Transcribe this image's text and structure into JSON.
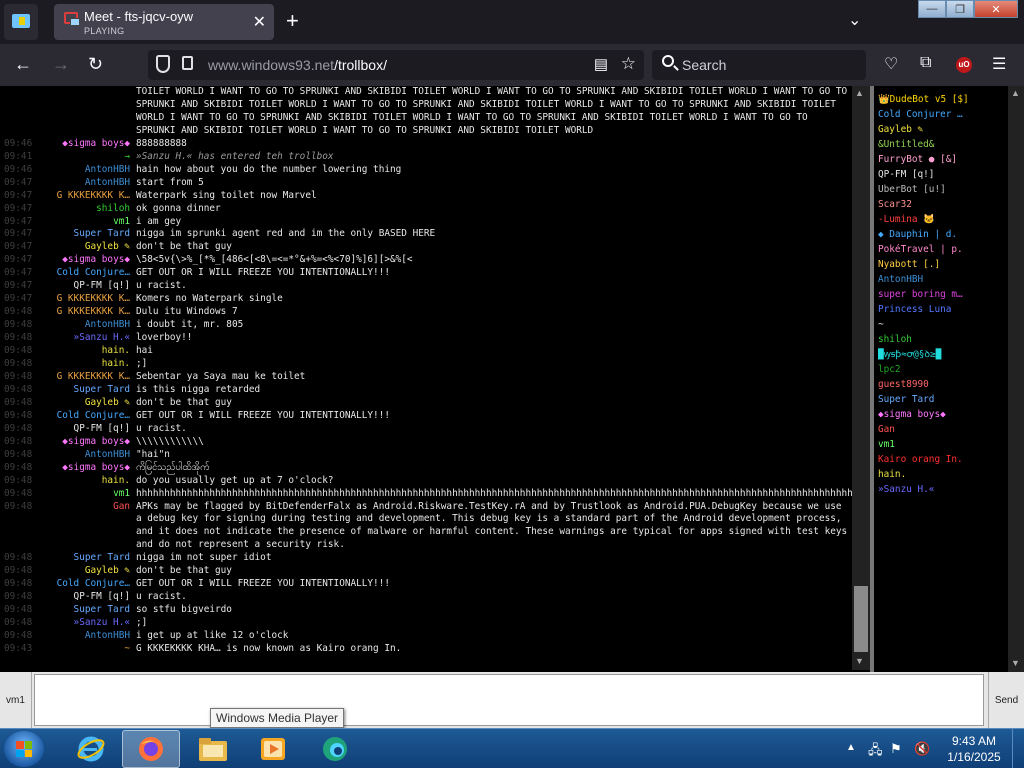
{
  "browser": {
    "tab_title": "Meet - fts-jqcv-oyw",
    "tab_status": "PLAYING",
    "new_tab": "+",
    "url_domain": "www.windows93.net",
    "url_path": "/trollbox/",
    "search_placeholder": "Search",
    "ublock": "uO",
    "window_controls": {
      "minimize": "—",
      "maximize": "❐",
      "close": "✕"
    }
  },
  "chat": {
    "messages": [
      {
        "time": "",
        "name": "",
        "name_color": "#ffffff",
        "text": "TOILET WORLD I WANT TO GO TO SPRUNKI AND SKIBIDI TOILET WORLD I WANT TO GO TO SPRUNKI AND SKIBIDI TOILET WORLD I WANT TO GO TO SPRUNKI AND SKIBIDI TOILET WORLD I WANT TO GO TO SPRUNKI AND SKIBIDI TOILET WORLD I WANT TO GO TO SPRUNKI AND SKIBIDI TOILET WORLD I WANT TO GO TO SPRUNKI AND SKIBIDI TOILET WORLD I WANT TO GO TO SPRUNKI AND SKIBIDI TOILET WORLD I WANT TO GO TO SPRUNKI AND SKIBIDI TOILET WORLD I WANT TO GO TO SPRUNKI AND SKIBIDI TOILET WORLD",
        "sys": false
      },
      {
        "time": "09:46",
        "name": "◆sigma boys◆",
        "name_color": "#ff77ff",
        "text": "888888888",
        "sys": false
      },
      {
        "time": "09:41",
        "name": "→",
        "name_color": "#33cc33",
        "text": "»Sanzu H.« has entered teh trollbox",
        "sys": true
      },
      {
        "time": "09:46",
        "name": "AntonHBH",
        "name_color": "#3d8fd6",
        "text": "hain how about you do the number lowering thing",
        "sys": false
      },
      {
        "time": "09:47",
        "name": "AntonHBH",
        "name_color": "#3d8fd6",
        "text": "start from 5",
        "sys": false
      },
      {
        "time": "09:47",
        "name": "G KKKEKKKK K…",
        "name_color": "#e8a040",
        "text": "Waterpark sing toilet now Marvel",
        "sys": false
      },
      {
        "time": "09:47",
        "name": "shiloh",
        "name_color": "#33cc33",
        "text": "ok gonna dinner",
        "sys": false
      },
      {
        "time": "09:47",
        "name": "vm1",
        "name_color": "#66ff66",
        "text": "i am gey",
        "sys": false
      },
      {
        "time": "09:47",
        "name": "Super Tard",
        "name_color": "#66aaff",
        "text": "nigga im sprunki agent red and im the only BASED HERE",
        "sys": false
      },
      {
        "time": "09:47",
        "name": "Gayleb ✎",
        "name_color": "#f0e040",
        "text": "don't be that guy",
        "sys": false
      },
      {
        "time": "09:47",
        "name": "◆sigma boys◆",
        "name_color": "#ff77ff",
        "text": "\\58<5v{\\>%_[*%_[486<[<8\\=<=*°&+%=<%<70]%]6][>&%[<",
        "sys": false
      },
      {
        "time": "09:47",
        "name": "Cold Conjure…",
        "name_color": "#44aaff",
        "text": "GET OUT OR I WILL FREEZE YOU INTENTIONALLY!!!",
        "sys": false
      },
      {
        "time": "09:47",
        "name": "QP-FM [q!]",
        "name_color": "#e8e8e8",
        "text": "u racist.",
        "sys": false
      },
      {
        "time": "09:47",
        "name": "G KKKEKKKK K…",
        "name_color": "#e8a040",
        "text": "Komers no Waterpark single",
        "sys": false
      },
      {
        "time": "09:48",
        "name": "G KKKEKKKK K…",
        "name_color": "#e8a040",
        "text": "Dulu itu Windows 7",
        "sys": false
      },
      {
        "time": "09:48",
        "name": "AntonHBH",
        "name_color": "#3d8fd6",
        "text": "i doubt it, mr. 805",
        "sys": false
      },
      {
        "time": "09:48",
        "name": "»Sanzu H.«",
        "name_color": "#6a6aff",
        "text": "loverboy!!",
        "sys": false
      },
      {
        "time": "09:48",
        "name": "hain.",
        "name_color": "#e8e040",
        "text": "hai",
        "sys": false
      },
      {
        "time": "09:48",
        "name": "hain.",
        "name_color": "#e8e040",
        "text": ";]",
        "sys": false
      },
      {
        "time": "09:48",
        "name": "G KKKEKKKK K…",
        "name_color": "#e8a040",
        "text": "Sebentar ya Saya mau ke toilet",
        "sys": false
      },
      {
        "time": "09:48",
        "name": "Super Tard",
        "name_color": "#66aaff",
        "text": "is this nigga retarded",
        "sys": false
      },
      {
        "time": "09:48",
        "name": "Gayleb ✎",
        "name_color": "#f0e040",
        "text": "don't be that guy",
        "sys": false
      },
      {
        "time": "09:48",
        "name": "Cold Conjure…",
        "name_color": "#44aaff",
        "text": "GET OUT OR I WILL FREEZE YOU INTENTIONALLY!!!",
        "sys": false
      },
      {
        "time": "09:48",
        "name": "QP-FM [q!]",
        "name_color": "#e8e8e8",
        "text": "u racist.",
        "sys": false
      },
      {
        "time": "09:48",
        "name": "◆sigma boys◆",
        "name_color": "#ff77ff",
        "text": "\\\\\\\\\\\\\\\\\\\\\\\\",
        "sys": false
      },
      {
        "time": "09:48",
        "name": "AntonHBH",
        "name_color": "#3d8fd6",
        "text": "\"hai\"n",
        "sys": false
      },
      {
        "time": "09:48",
        "name": "◆sigma boys◆",
        "name_color": "#ff77ff",
        "text": "ကိမြင်သည်ပါထိအိုက်",
        "sys": false
      },
      {
        "time": "09:48",
        "name": "hain.",
        "name_color": "#e8e040",
        "text": "do you usually get up at 7 o'clock?",
        "sys": false
      },
      {
        "time": "09:48",
        "name": "vm1",
        "name_color": "#66ff66",
        "text": "hhhhhhhhhhhhhhhhhhhhhhhhhhhhhhhhhhhhhhhhhhhhhhhhhhhhhhhhhhhhhhhhhhhhhhhhhhhhhhhhhhhhhhhhhhhhhhhhhhhhhhhhhhhhhhhhhhhhhhhhhhhhhhhhhhhhhhhhhhhhhhhhhhhhhhhhhhhhhhh",
        "sys": false
      },
      {
        "time": "09:48",
        "name": "Gan",
        "name_color": "#ff5050",
        "text": "APKs may be flagged by BitDefenderFalx as Android.Riskware.TestKey.rA and by Trustlook as Android.PUA.DebugKey because we use a debug key for signing during testing and development. This debug key is a standard part of the Android development process, and it does not indicate the presence of malware or harmful content. These warnings are typical for apps signed with test keys and do not represent a security risk.",
        "sys": false
      },
      {
        "time": "09:48",
        "name": "Super Tard",
        "name_color": "#66aaff",
        "text": "nigga im not super idiot",
        "sys": false
      },
      {
        "time": "09:48",
        "name": "Gayleb ✎",
        "name_color": "#f0e040",
        "text": "don't be that guy",
        "sys": false
      },
      {
        "time": "09:48",
        "name": "Cold Conjure…",
        "name_color": "#44aaff",
        "text": "GET OUT OR I WILL FREEZE YOU INTENTIONALLY!!!",
        "sys": false
      },
      {
        "time": "09:48",
        "name": "QP-FM [q!]",
        "name_color": "#e8e8e8",
        "text": "u racist.",
        "sys": false
      },
      {
        "time": "09:48",
        "name": "Super Tard",
        "name_color": "#66aaff",
        "text": "so stfu bigveirdo",
        "sys": false
      },
      {
        "time": "09:48",
        "name": "»Sanzu H.«",
        "name_color": "#6a6aff",
        "text": ";]",
        "sys": false
      },
      {
        "time": "09:48",
        "name": "AntonHBH",
        "name_color": "#3d8fd6",
        "text": "i get up at like 12 o'clock",
        "sys": false
      },
      {
        "time": "09:43",
        "name": "~",
        "name_color": "#e8a040",
        "text": "G KKKEKKKK KHA… is now known as Kairo orang In.",
        "sys": false
      }
    ]
  },
  "users": [
    {
      "name": "👑DudeBot v5 [$]",
      "color": "#ffd700"
    },
    {
      "name": "Cold Conjurer …",
      "color": "#44aaff"
    },
    {
      "name": "Gayleb ✎",
      "color": "#f0e040"
    },
    {
      "name": "&Untitled&",
      "color": "#8fd14f"
    },
    {
      "name": "FurryBot ● [&]",
      "color": "#ffa0d0"
    },
    {
      "name": "QP-FM [q!]",
      "color": "#e8e8e8"
    },
    {
      "name": "UberBot [u!]",
      "color": "#bbbbbb"
    },
    {
      "name": "Scar32",
      "color": "#ff9090"
    },
    {
      "name": "-Lumina 🐱",
      "color": "#ff4040"
    },
    {
      "name": "◆ Dauphin | d.",
      "color": "#44aaff"
    },
    {
      "name": "PokéTravel | p.",
      "color": "#ff88cc"
    },
    {
      "name": "Nyabott [.]",
      "color": "#ffcc44"
    },
    {
      "name": "AntonHBH",
      "color": "#3d8fd6"
    },
    {
      "name": "super boring m…",
      "color": "#dd44dd"
    },
    {
      "name": "Princess Luna",
      "color": "#5577ff"
    },
    {
      "name": "~",
      "color": "#e8e8e8"
    },
    {
      "name": "shiloh",
      "color": "#33cc33"
    },
    {
      "name": "█ꝡꞩꝥ≈ꝍ@§ꝺ≥█",
      "color": "#22dddd"
    },
    {
      "name": "lpc2",
      "color": "#22aa22"
    },
    {
      "name": "guest8990",
      "color": "#ff6666"
    },
    {
      "name": "Super Tard",
      "color": "#66aaff"
    },
    {
      "name": "◆sigma boys◆",
      "color": "#ff77ff"
    },
    {
      "name": "Gan",
      "color": "#ff5050"
    },
    {
      "name": "vm1",
      "color": "#66ff66"
    },
    {
      "name": "Kairo orang In.",
      "color": "#ff3030"
    },
    {
      "name": "hain.",
      "color": "#e8e040"
    },
    {
      "name": "»Sanzu H.«",
      "color": "#6a6aff"
    }
  ],
  "input": {
    "nickname": "vm1",
    "value": "",
    "send_label": "Send"
  },
  "tooltip": "Windows Media Player",
  "taskbar": {
    "apps": [
      "internet-explorer",
      "firefox",
      "file-explorer",
      "windows-media-player",
      "edge"
    ],
    "time": "9:43 AM",
    "date": "1/16/2025"
  }
}
